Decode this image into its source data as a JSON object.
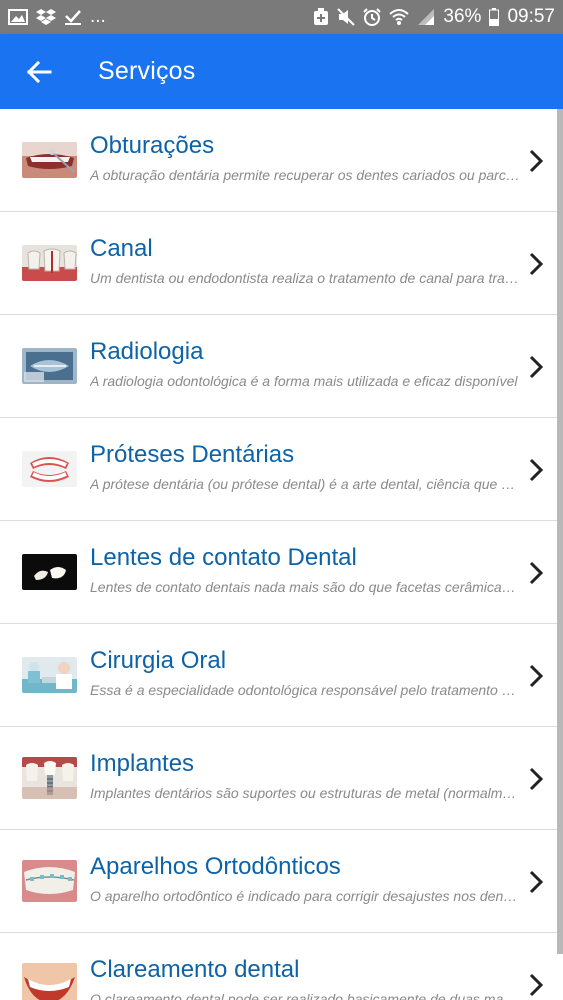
{
  "status_bar": {
    "overflow": "...",
    "battery": "36%",
    "time": "09:57"
  },
  "app_bar": {
    "title": "Serviços"
  },
  "services": [
    {
      "title": "Obturações",
      "description": "A obturação dentária permite recuperar os dentes cariados ou parcialmente destruídos",
      "thumb": "teeth-mirror-photo"
    },
    {
      "title": "Canal",
      "description": "Um dentista ou endodontista realiza o tratamento de canal para tratar a polpa",
      "thumb": "root-canal-photo"
    },
    {
      "title": "Radiologia",
      "description": "A radiologia odontológica é a forma mais utilizada e eficaz disponível",
      "thumb": "xray-photo"
    },
    {
      "title": "Próteses Dentárias",
      "description": "A prótese dentária (ou prótese dental) é a arte dental, ciência que cuida",
      "thumb": "denture-photo"
    },
    {
      "title": "Lentes de contato Dental",
      "description": "Lentes de contato dentais nada mais são do que facetas cerâmicas ultrafinas",
      "thumb": "veneer-photo"
    },
    {
      "title": "Cirurgia Oral",
      "description": "Essa é a especialidade odontológica responsável pelo tratamento cirúrgico",
      "thumb": "surgery-photo"
    },
    {
      "title": "Implantes",
      "description": "Implantes dentários são suportes ou estruturas de metal (normalmente titânio)",
      "thumb": "implant-photo"
    },
    {
      "title": "Aparelhos Ortodônticos",
      "description": "O aparelho ortodôntico é indicado para corrigir desajustes nos dentes",
      "thumb": "braces-photo"
    },
    {
      "title": "Clareamento dental",
      "description": "O clareamento dental pode ser realizado basicamente de duas maneiras",
      "thumb": "whitening-photo"
    }
  ],
  "colors": {
    "app_bar": "#1a73f0",
    "title_text": "#0d63a8",
    "status_bar": "#7a7a7a"
  }
}
